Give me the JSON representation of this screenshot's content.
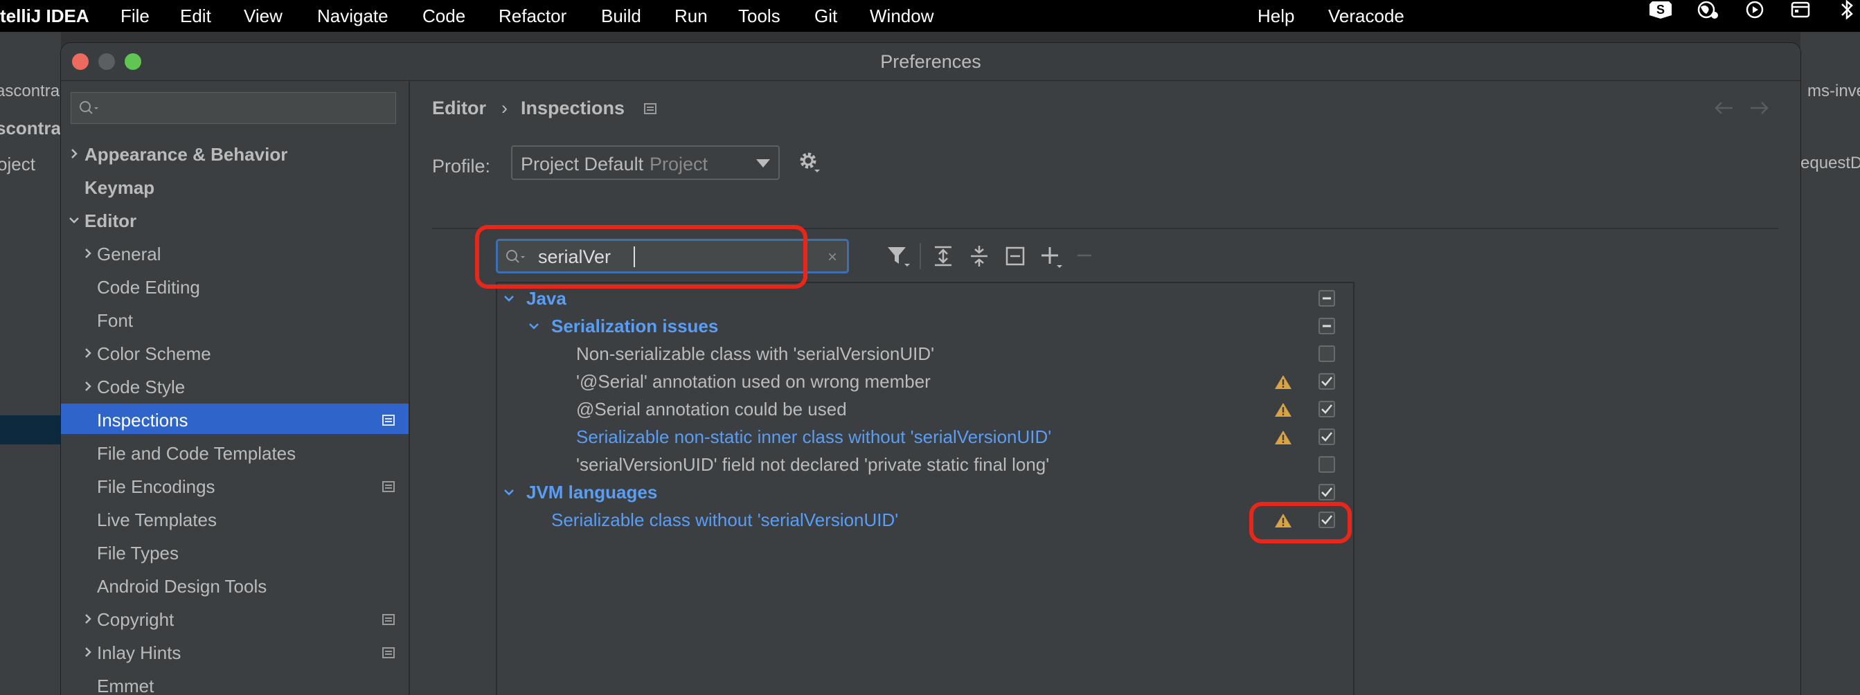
{
  "menubar": {
    "app": "telliJ IDEA",
    "items": [
      "File",
      "Edit",
      "View",
      "Navigate",
      "Code",
      "Refactor",
      "Build",
      "Run",
      "Tools",
      "Git",
      "Window"
    ],
    "help": "Help",
    "veracode": "Veracode",
    "tray_icons": [
      "s-badge-icon",
      "globe-icon",
      "play-circle-icon",
      "calendar-icon",
      "bluetooth-icon"
    ]
  },
  "background": {
    "left_texts": [
      "ascontra",
      "scontra",
      "oject"
    ],
    "right_texts": [
      "ms-inve",
      "equestD"
    ]
  },
  "dialog": {
    "title": "Preferences"
  },
  "sidebar": {
    "search_placeholder": "",
    "items": [
      {
        "label": "Appearance & Behavior",
        "level": 0,
        "bold": true,
        "chevron": "right"
      },
      {
        "label": "Keymap",
        "level": 0,
        "bold": true
      },
      {
        "label": "Editor",
        "level": 0,
        "bold": true,
        "chevron": "down"
      },
      {
        "label": "General",
        "level": 1,
        "chevron": "right"
      },
      {
        "label": "Code Editing",
        "level": 1
      },
      {
        "label": "Font",
        "level": 1
      },
      {
        "label": "Color Scheme",
        "level": 1,
        "chevron": "right"
      },
      {
        "label": "Code Style",
        "level": 1,
        "chevron": "right"
      },
      {
        "label": "Inspections",
        "level": 1,
        "selected": true,
        "project": true
      },
      {
        "label": "File and Code Templates",
        "level": 1
      },
      {
        "label": "File Encodings",
        "level": 1,
        "project": true
      },
      {
        "label": "Live Templates",
        "level": 1
      },
      {
        "label": "File Types",
        "level": 1
      },
      {
        "label": "Android Design Tools",
        "level": 1
      },
      {
        "label": "Copyright",
        "level": 1,
        "chevron": "right",
        "project": true
      },
      {
        "label": "Inlay Hints",
        "level": 1,
        "chevron": "right",
        "project": true
      },
      {
        "label": "Emmet",
        "level": 1
      }
    ]
  },
  "main": {
    "breadcrumb": [
      "Editor",
      "Inspections"
    ],
    "breadcrumb_separator": "›",
    "profile_label": "Profile:",
    "profile_value": "Project Default",
    "profile_scope": "Project",
    "filter_value": "serialVer",
    "filter_clear": "×",
    "toolbar": [
      "filter-icon",
      "expand-all-icon",
      "collapse-all-icon",
      "reset-icon",
      "add-icon",
      "remove-icon"
    ],
    "tree": [
      {
        "label": "Java",
        "level": 0,
        "style": "group",
        "chevron": "down",
        "check": "partial"
      },
      {
        "label": "Serialization issues",
        "level": 1,
        "style": "group",
        "chevron": "down",
        "check": "partial"
      },
      {
        "label": "Non-serializable class with 'serialVersionUID'",
        "level": 2,
        "style": "normal",
        "warning": false,
        "check": "off"
      },
      {
        "label": "'@Serial' annotation used on wrong member",
        "level": 2,
        "style": "normal",
        "warning": true,
        "check": "on"
      },
      {
        "label": "@Serial annotation could be used",
        "level": 2,
        "style": "normal",
        "warning": true,
        "check": "on"
      },
      {
        "label": "Serializable non-static inner class without 'serialVersionUID'",
        "level": 2,
        "style": "link",
        "warning": true,
        "check": "on"
      },
      {
        "label": "'serialVersionUID' field not declared 'private static final long'",
        "level": 2,
        "style": "normal",
        "warning": false,
        "check": "off"
      },
      {
        "label": "JVM languages",
        "level": 0,
        "style": "group",
        "chevron": "down",
        "check": "on"
      },
      {
        "label": "Serializable class without 'serialVersionUID'",
        "level": 1,
        "style": "link",
        "warning": true,
        "check": "on"
      }
    ]
  },
  "colors": {
    "accent_blue": "#589df6",
    "selection": "#2f65ca",
    "warning": "#d9a343",
    "annotation_red": "#e8271a"
  }
}
